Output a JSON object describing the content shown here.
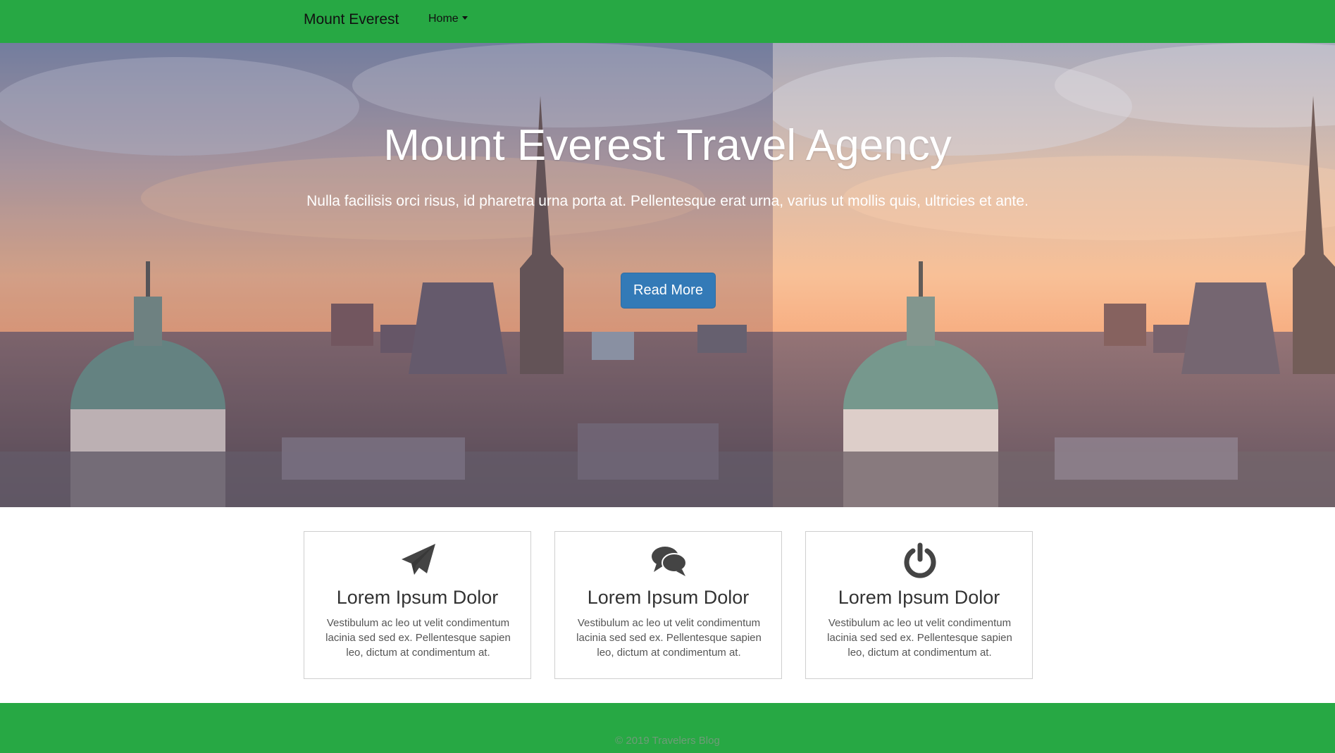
{
  "nav": {
    "brand": "Mount Everest",
    "home_label": "Home"
  },
  "hero": {
    "title": "Mount Everest Travel Agency",
    "subtitle": "Nulla facilisis orci risus, id pharetra urna porta at. Pellentesque erat urna, varius ut mollis quis, ultricies et ante.",
    "button_label": "Read More"
  },
  "features": [
    {
      "icon": "paper-plane-icon",
      "title": "Lorem Ipsum Dolor",
      "text": "Vestibulum ac leo ut velit condimentum lacinia sed sed ex. Pellentesque sapien leo, dictum at condimentum at."
    },
    {
      "icon": "comments-icon",
      "title": "Lorem Ipsum Dolor",
      "text": "Vestibulum ac leo ut velit condimentum lacinia sed sed ex. Pellentesque sapien leo, dictum at condimentum at."
    },
    {
      "icon": "power-icon",
      "title": "Lorem Ipsum Dolor",
      "text": "Vestibulum ac leo ut velit condimentum lacinia sed sed ex. Pellentesque sapien leo, dictum at condimentum at."
    }
  ],
  "footer": {
    "copyright": "© 2019 Travelers Blog"
  },
  "colors": {
    "navbar": "#27a844",
    "footer": "#27a844",
    "button": "#337ab7",
    "icon": "#444444"
  }
}
